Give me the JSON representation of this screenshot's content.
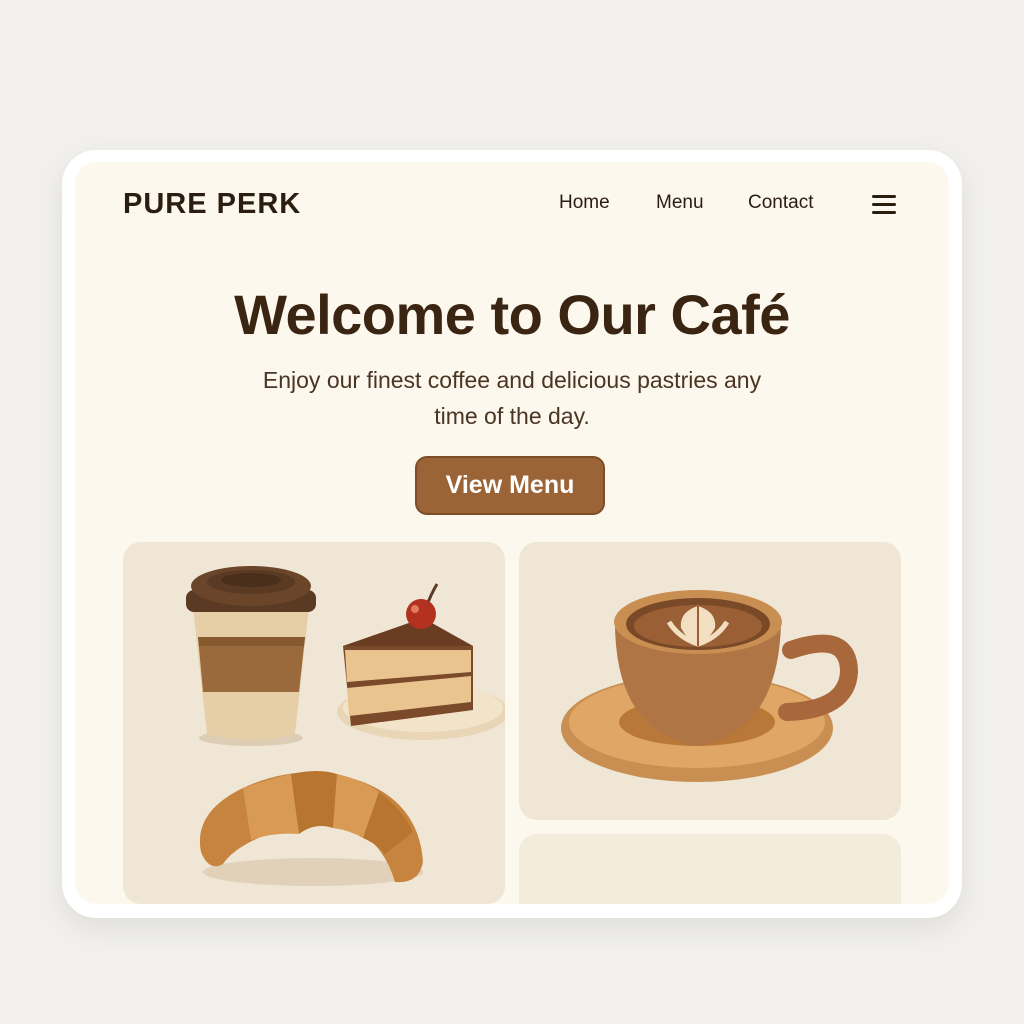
{
  "header": {
    "brand": "PURE PERK",
    "nav": [
      {
        "label": "Home"
      },
      {
        "label": "Menu"
      },
      {
        "label": "Contact"
      }
    ],
    "menu_icon": "hamburger-menu-icon"
  },
  "hero": {
    "title": "Welcome to Our Café",
    "subtitle": "Enjoy our finest coffee and delicious pastries any time of the day.",
    "cta_label": "View Menu"
  },
  "colors": {
    "page_background": "#fcf8ee",
    "brand_text": "#2b1d10",
    "button": "#9b6436",
    "card_background": "#efe6d6"
  },
  "images": [
    {
      "name": "coffee-cake-croissant-illustration"
    },
    {
      "name": "latte-cup-illustration"
    }
  ]
}
